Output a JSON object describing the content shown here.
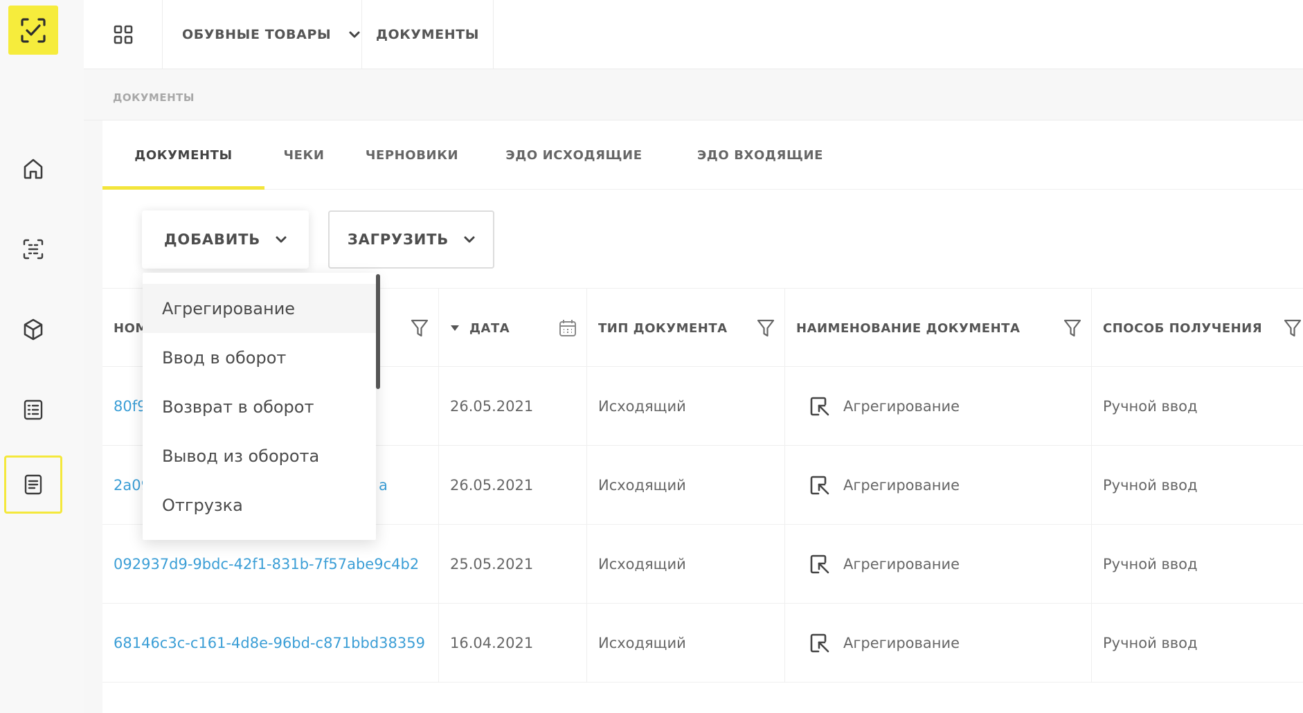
{
  "top_nav": {
    "products_label": "ОБУВНЫЕ ТОВАРЫ",
    "documents_label": "ДОКУМЕНТЫ"
  },
  "breadcrumb": "ДОКУМЕНТЫ",
  "tabs": [
    {
      "label": "ДОКУМЕНТЫ",
      "active": true
    },
    {
      "label": "ЧЕКИ"
    },
    {
      "label": "ЧЕРНОВИКИ"
    },
    {
      "label": "ЭДО ИСХОДЯЩИЕ"
    },
    {
      "label": "ЭДО ВХОДЯЩИЕ"
    }
  ],
  "toolbar": {
    "add_label": "ДОБАВИТЬ",
    "upload_label": "ЗАГРУЗИТЬ"
  },
  "table": {
    "columns": {
      "number": "НОМ",
      "date": "ДАТА",
      "doc_type": "ТИП ДОКУМЕНТА",
      "doc_name": "НАИМЕНОВАНИЕ ДОКУМЕНТА",
      "method": "СПОСОБ ПОЛУЧЕНИЯ"
    },
    "rows": [
      {
        "number": "80f9",
        "date": "26.05.2021",
        "type": "Исходящий",
        "name": "Агрегирование",
        "method": "Ручной ввод"
      },
      {
        "number": "2a09",
        "number_tail": "a",
        "date": "26.05.2021",
        "type": "Исходящий",
        "name": "Агрегирование",
        "method": "Ручной ввод"
      },
      {
        "number": "092937d9-9bdc-42f1-831b-7f57abe9c4b2",
        "date": "25.05.2021",
        "type": "Исходящий",
        "name": "Агрегирование",
        "method": "Ручной ввод"
      },
      {
        "number": "68146c3c-c161-4d8e-96bd-c871bbd38359",
        "date": "16.04.2021",
        "type": "Исходящий",
        "name": "Агрегирование",
        "method": "Ручной ввод"
      }
    ]
  },
  "add_menu": {
    "items": [
      "Агрегирование",
      "Ввод в оборот",
      "Возврат в оборот",
      "Вывод из оборота",
      "Отгрузка"
    ]
  },
  "colors": {
    "accent": "#f3e53b",
    "link": "#3b9ed6"
  }
}
